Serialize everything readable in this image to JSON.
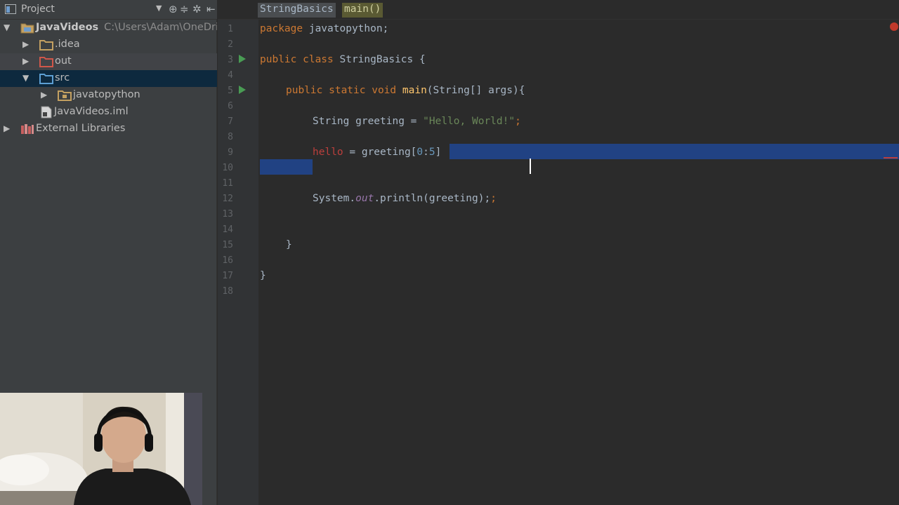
{
  "project_panel": {
    "title": "Project",
    "tree": [
      {
        "label": "JavaVideos",
        "path": "C:\\Users\\Adam\\OneDriv",
        "expanded": true
      },
      {
        "label": ".idea"
      },
      {
        "label": "out"
      },
      {
        "label": "src",
        "expanded": true,
        "selected": true
      },
      {
        "label": "javatopython"
      },
      {
        "label": "JavaVideos.iml"
      },
      {
        "label": "External Libraries"
      }
    ]
  },
  "editor": {
    "breadcrumbs": [
      "StringBasics",
      "main()"
    ],
    "line_numbers": [
      "1",
      "2",
      "3",
      "4",
      "5",
      "6",
      "7",
      "8",
      "9",
      "10",
      "11",
      "12",
      "13",
      "14",
      "15",
      "16",
      "17",
      "18"
    ],
    "code": {
      "l1_kw": "package",
      "l1_rest": " javatopython;",
      "l3_kw": "public class",
      "l3_name": " StringBasics ",
      "l3_brace": "{",
      "l5_kw": "public static void",
      "l5_fn": "main",
      "l5_rest": "(String[] args){",
      "l7_type": "String greeting = ",
      "l7_str": "\"Hello, World!\"",
      "l7_end": ";",
      "l9_err": "hello",
      "l9_mid": " = greeting[",
      "l9_n1": "0",
      "l9_colon": ":",
      "l9_n2": "5",
      "l9_end": "]",
      "l12_a": "System.",
      "l12_fld": "out",
      "l12_b": ".println(greeting);",
      "l15": "}",
      "l17": "}"
    }
  },
  "colors": {
    "panel_bg": "#3c3f41",
    "editor_bg": "#2b2b2b",
    "selection": "#214283",
    "keyword": "#cc7832",
    "string": "#6a8759",
    "error": "#bc3f3c"
  }
}
